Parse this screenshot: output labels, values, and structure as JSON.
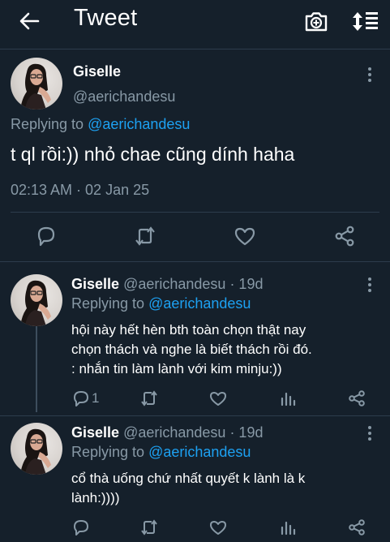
{
  "header": {
    "title": "Tweet",
    "icons": [
      "back-arrow-icon",
      "camera-icon",
      "sort-icon"
    ]
  },
  "main_tweet": {
    "name": "Giselle",
    "handle": "@aerichandesu",
    "replying_prefix": "Replying to",
    "replying_to": "@aerichandesu",
    "text": "t ql rồi:)) nhỏ chae cũng dính haha",
    "timestamp": "02:13 AM · 02 Jan 25",
    "actions": [
      "reply-icon",
      "retweet-icon",
      "like-icon",
      "share-icon"
    ]
  },
  "replies": [
    {
      "name": "Giselle",
      "handle": "@aerichandesu",
      "time": "· 19d",
      "replying_prefix": "Replying to",
      "replying_to": "@aerichandesu",
      "text_lines": [
        "hội này hết hèn bth toàn chọn thật nay",
        "chọn thách và nghe là biết thách rồi đó.",
        ": nhắn tin làm lành với kim minju:))"
      ],
      "reply_count": "1"
    },
    {
      "name": "Giselle",
      "handle": "@aerichandesu",
      "time": "· 19d",
      "replying_prefix": "Replying to",
      "replying_to": "@aerichandesu",
      "text_lines": [
        "cổ thà uống chứ nhất quyết k lành là k",
        "lành:))))"
      ],
      "reply_count": ""
    }
  ],
  "colors": {
    "background": "#15202b",
    "accent": "#1da1f2",
    "secondary_text": "#8899a6",
    "divider": "#2d3c4c"
  }
}
